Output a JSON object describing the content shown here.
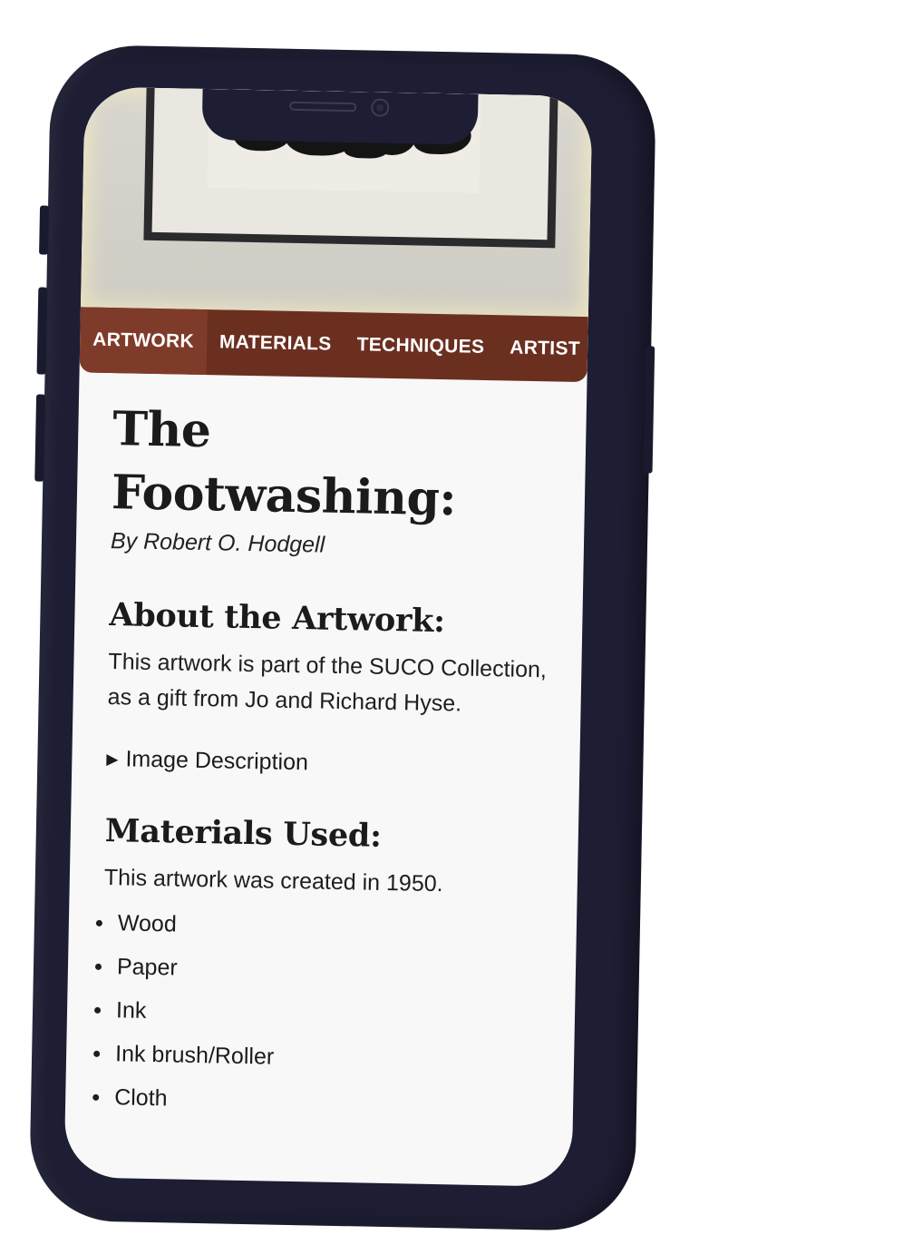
{
  "nav": {
    "items": [
      {
        "label": "ARTWORK",
        "active": true
      },
      {
        "label": "MATERIALS",
        "active": false
      },
      {
        "label": "TECHNIQUES",
        "active": false
      },
      {
        "label": "ARTIST",
        "active": false
      }
    ]
  },
  "artwork": {
    "title_line1": "The",
    "title_line2": "Footwashing:",
    "byline": "By Robert O. Hodgell"
  },
  "about": {
    "heading": "About the Artwork:",
    "text": "This artwork is part of the SUCO Collection, as a gift from Jo and Richard Hyse.",
    "image_description_toggle": "Image Description"
  },
  "materials": {
    "heading": "Materials Used:",
    "intro": "This artwork was created in 1950.",
    "items": [
      "Wood",
      "Paper",
      "Ink",
      "Ink brush/Roller",
      "Cloth"
    ]
  },
  "colors": {
    "nav_background": "#6b2f20",
    "nav_active": "#7f3b2a",
    "phone_body": "#1d1d33",
    "screen_background": "#f8f8f8"
  }
}
